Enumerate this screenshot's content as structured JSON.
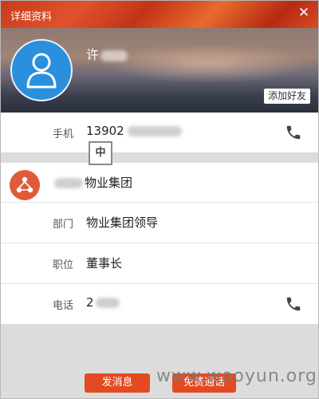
{
  "window": {
    "title": "详细资料",
    "close_icon": "close-icon"
  },
  "profile": {
    "name": "许",
    "add_friend_label": "添加好友",
    "avatar_color": "#2a8fdd"
  },
  "mobile": {
    "label": "手机",
    "value": "13902"
  },
  "ime": {
    "indicator": "中"
  },
  "organization": {
    "name": "物业集团"
  },
  "details": {
    "department": {
      "label": "部门",
      "value": "物业集团领导"
    },
    "position": {
      "label": "职位",
      "value": "董事长"
    },
    "phone": {
      "label": "电话",
      "value": "2"
    }
  },
  "footer": {
    "send_message": "发消息",
    "free_call": "免费通话"
  },
  "watermark": "www.wooyun.org",
  "colors": {
    "accent": "#e34a22",
    "phone_icon": "#444444"
  }
}
